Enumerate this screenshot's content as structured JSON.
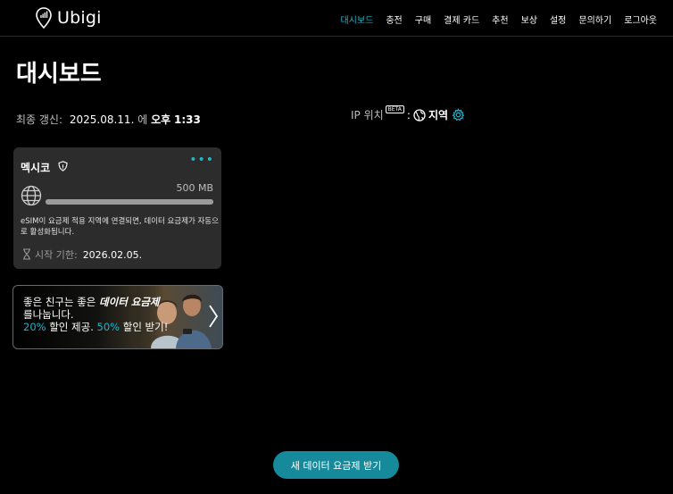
{
  "brand": {
    "name": "Ubigi",
    "accent": "#1fb4c9",
    "cta_color": "#16899a"
  },
  "nav": [
    {
      "label": "대시보드",
      "active": true
    },
    {
      "label": "충전"
    },
    {
      "label": "구매"
    },
    {
      "label": "결제 카드"
    },
    {
      "label": "추천"
    },
    {
      "label": "보상"
    },
    {
      "label": "설정"
    },
    {
      "label": "문의하기"
    },
    {
      "label": "로그아웃"
    }
  ],
  "page": {
    "title": "대시보드"
  },
  "updated": {
    "label": "최종 갱신:",
    "date": "2025.08.11.",
    "connector": "에",
    "ampm": "오후",
    "time": "1:33"
  },
  "ip": {
    "label": "IP 위치",
    "beta": "BETA",
    "colon": ":",
    "region": "지역"
  },
  "card": {
    "country": "멕시코",
    "data": "500 MB",
    "usage_fraction": 1.0,
    "note": "eSIM이 요금제 적용 지역에 연결되면, 데이터 요금제가 자동으로 활성화됩니다.",
    "start_label": "시작 기한:",
    "start_date": "2026.02.05."
  },
  "promo": {
    "line1_a": "좋은 친구는 좋은 ",
    "line1_b": "데이터 요금제",
    "line2": "를나눕니다.",
    "pct1": "20%",
    "mid": " 할인 제공. ",
    "pct2": "50%",
    "end": " 할인 받기!"
  },
  "cta": {
    "label": "새 데이터 요금제 받기"
  }
}
